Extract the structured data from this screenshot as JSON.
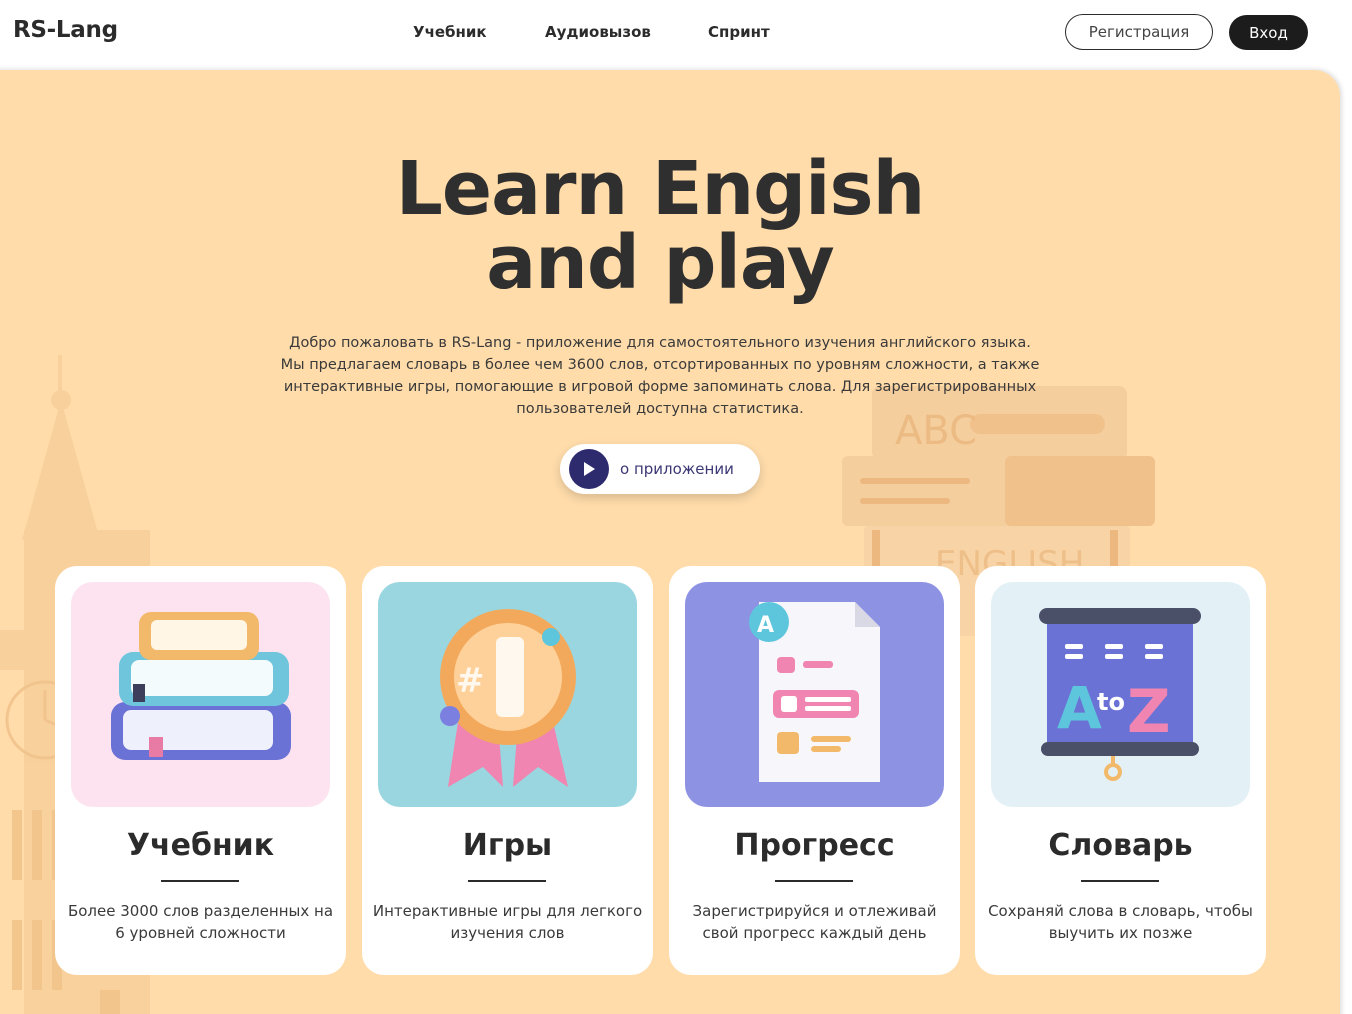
{
  "header": {
    "logo": "RS-Lang",
    "nav": [
      {
        "label": "Учебник"
      },
      {
        "label": "Аудиовызов"
      },
      {
        "label": "Спринт"
      }
    ],
    "register_label": "Регистрация",
    "login_label": "Вход"
  },
  "hero": {
    "title_line1": "Learn Engish",
    "title_line2": "and play",
    "description": "Добро пожаловать в RS-Lang - приложение для самостоятельного изучения английского языка. Мы предлагаем словарь в более чем 3600 слов, отсортированных по уровням сложности, а также интерактивные игры, помогающие в игровой форме запоминать слова. Для зарегистрированных пользователей доступна статистика.",
    "about_label": "о приложении",
    "background_text": [
      "ABC",
      "ENGLISH"
    ]
  },
  "cards": [
    {
      "title": "Учебник",
      "text": "Более 3000 слов разделенных на 6 уровней сложности",
      "icon": "books-stack-icon",
      "bg": "#fde3f0"
    },
    {
      "title": "Игры",
      "text": "Интерактивные игры для легкого изучения слов",
      "icon": "medal-number-one-icon",
      "bg": "#9ad6e0"
    },
    {
      "title": "Прогресс",
      "text": "Зарегистрируйся и отлеживай свой прогресс каждый день",
      "icon": "grade-report-icon",
      "bg": "#8e92e3"
    },
    {
      "title": "Словарь",
      "text": "Сохраняй слова в словарь, чтобы выучить их позже",
      "icon": "a-to-z-board-icon",
      "bg": "#e3f1f6"
    }
  ],
  "colors": {
    "hero_bg": "#ffdcaa",
    "dark": "#1c1c1c",
    "play": "#2e2a6e"
  }
}
